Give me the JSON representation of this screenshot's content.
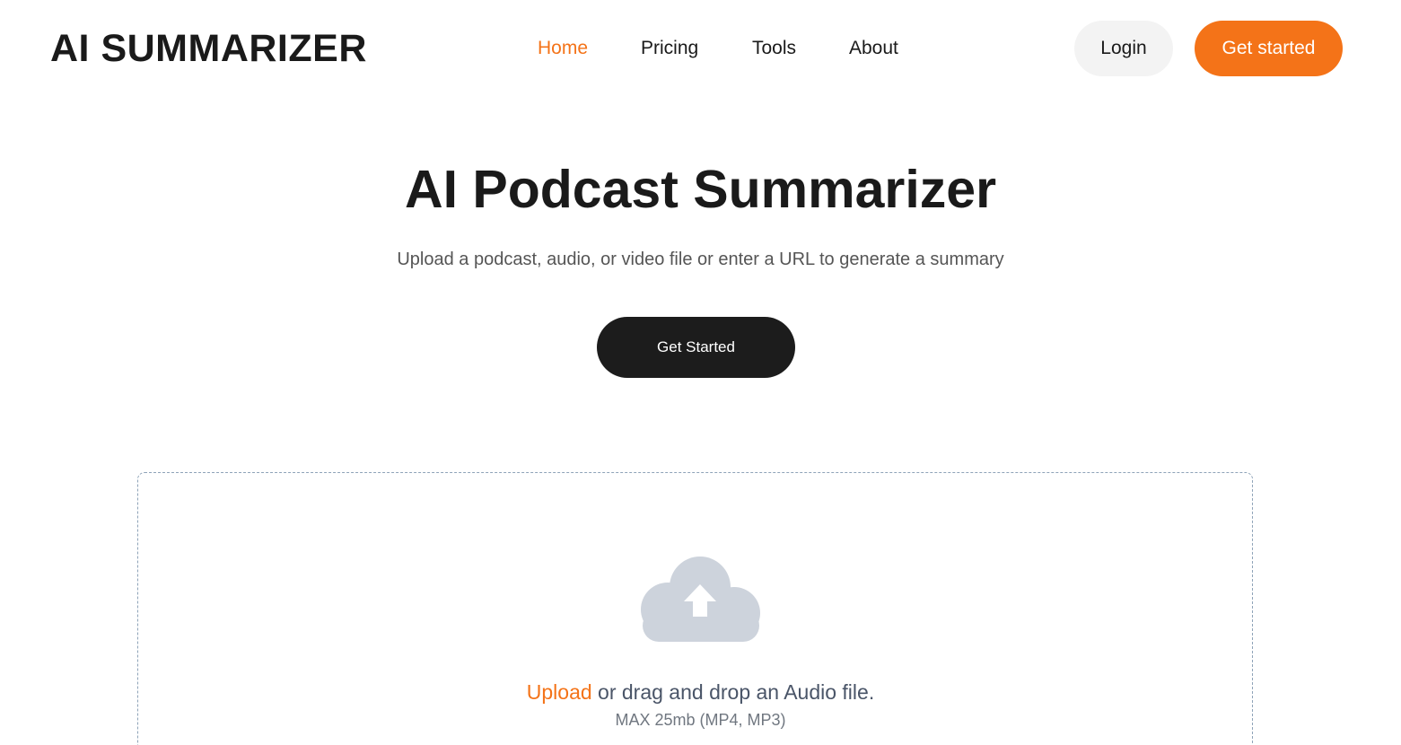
{
  "header": {
    "logo": "AI SUMMARIZER",
    "nav": [
      {
        "label": "Home",
        "active": true
      },
      {
        "label": "Pricing",
        "active": false
      },
      {
        "label": "Tools",
        "active": false
      },
      {
        "label": "About",
        "active": false
      }
    ],
    "login_label": "Login",
    "get_started_label": "Get started"
  },
  "hero": {
    "title": "AI Podcast Summarizer",
    "subtitle": "Upload a podcast, audio, or video file or enter a URL to generate a summary",
    "cta_label": "Get Started"
  },
  "dropzone": {
    "icon": "cloud-upload-icon",
    "upload_link": "Upload",
    "upload_text": " or drag and drop an Audio file.",
    "hint": "MAX 25mb (MP4, MP3)"
  },
  "colors": {
    "accent": "#f47318",
    "dark_button": "#1c1c1c",
    "icon_gray": "#cdd3dc",
    "dropzone_border": "#8ea3b8"
  }
}
